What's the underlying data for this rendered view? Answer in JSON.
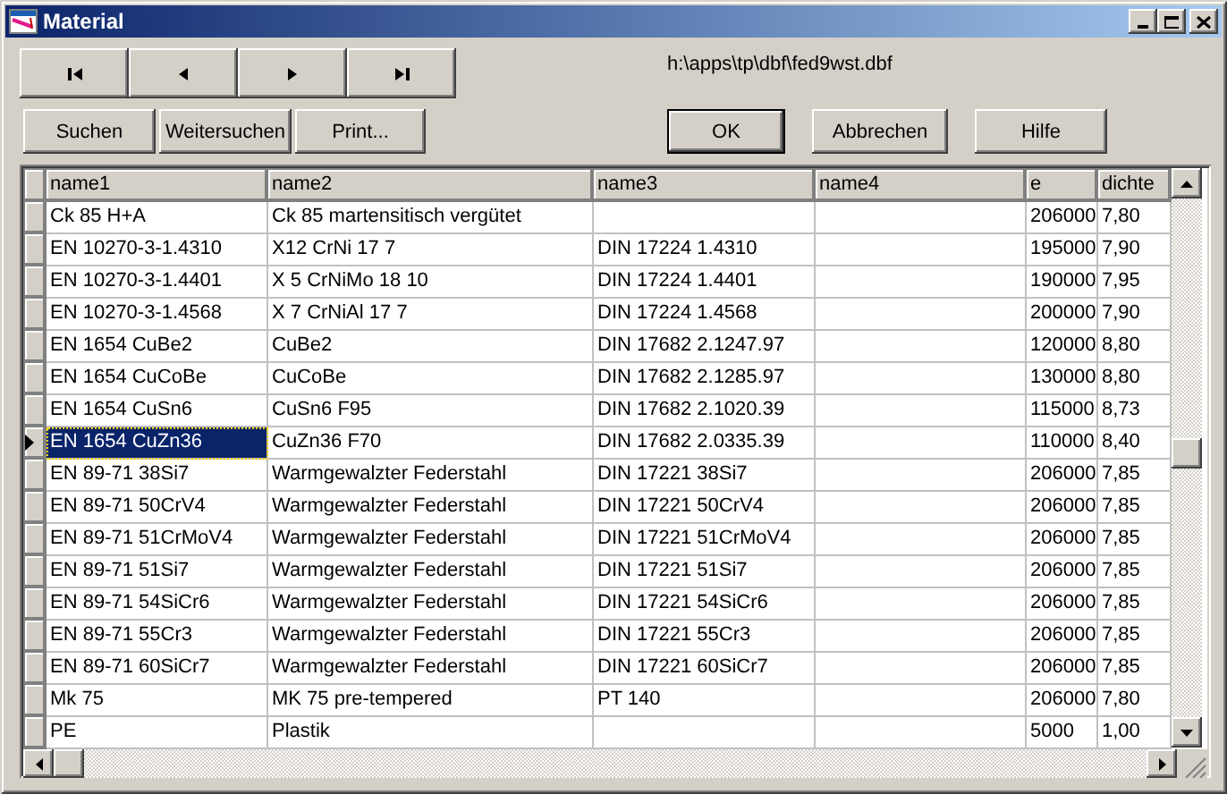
{
  "window": {
    "title": "Material"
  },
  "nav_buttons": [
    {
      "kind": "first"
    },
    {
      "kind": "previous"
    },
    {
      "kind": "next"
    },
    {
      "kind": "last"
    }
  ],
  "file_path": "h:\\apps\\tp\\dbf\\fed9wst.dbf",
  "left_buttons": [
    "Suchen",
    "Weitersuchen",
    "Print..."
  ],
  "right_buttons": [
    {
      "label": "OK",
      "default": true
    },
    {
      "label": "Abbrechen",
      "default": false
    },
    {
      "label": "Hilfe",
      "default": false
    }
  ],
  "table": {
    "columns": [
      "name1",
      "name2",
      "name3",
      "name4",
      "e",
      "dichte"
    ],
    "rows": [
      {
        "selected": false,
        "cells": [
          "Ck 85 H+A",
          "Ck 85 martensitisch vergütet",
          "",
          "",
          "206000",
          "7,80"
        ]
      },
      {
        "selected": false,
        "cells": [
          "EN 10270-3-1.4310",
          "X12 CrNi 17 7",
          "DIN 17224 1.4310",
          "",
          "195000",
          "7,90"
        ]
      },
      {
        "selected": false,
        "cells": [
          "EN 10270-3-1.4401",
          "X 5 CrNiMo 18 10",
          "DIN 17224 1.4401",
          "",
          "190000",
          "7,95"
        ]
      },
      {
        "selected": false,
        "cells": [
          "EN 10270-3-1.4568",
          "X 7 CrNiAl 17 7",
          "DIN 17224 1.4568",
          "",
          "200000",
          "7,90"
        ]
      },
      {
        "selected": false,
        "cells": [
          "EN 1654 CuBe2",
          "CuBe2",
          "DIN 17682 2.1247.97",
          "",
          "120000",
          "8,80"
        ]
      },
      {
        "selected": false,
        "cells": [
          "EN 1654 CuCoBe",
          "CuCoBe",
          "DIN 17682 2.1285.97",
          "",
          "130000",
          "8,80"
        ]
      },
      {
        "selected": false,
        "cells": [
          "EN 1654 CuSn6",
          "CuSn6 F95",
          "DIN 17682 2.1020.39",
          "",
          "115000",
          "8,73"
        ]
      },
      {
        "selected": true,
        "cells": [
          "EN 1654 CuZn36",
          "CuZn36 F70",
          "DIN 17682 2.0335.39",
          "",
          "110000",
          "8,40"
        ]
      },
      {
        "selected": false,
        "cells": [
          "EN 89-71 38Si7",
          "Warmgewalzter Federstahl",
          "DIN 17221 38Si7",
          "",
          "206000",
          "7,85"
        ]
      },
      {
        "selected": false,
        "cells": [
          "EN 89-71 50CrV4",
          "Warmgewalzter Federstahl",
          "DIN 17221 50CrV4",
          "",
          "206000",
          "7,85"
        ]
      },
      {
        "selected": false,
        "cells": [
          "EN 89-71 51CrMoV4",
          "Warmgewalzter Federstahl",
          "DIN 17221 51CrMoV4",
          "",
          "206000",
          "7,85"
        ]
      },
      {
        "selected": false,
        "cells": [
          "EN 89-71 51Si7",
          "Warmgewalzter Federstahl",
          "DIN 17221 51Si7",
          "",
          "206000",
          "7,85"
        ]
      },
      {
        "selected": false,
        "cells": [
          "EN 89-71 54SiCr6",
          "Warmgewalzter Federstahl",
          "DIN 17221 54SiCr6",
          "",
          "206000",
          "7,85"
        ]
      },
      {
        "selected": false,
        "cells": [
          "EN 89-71 55Cr3",
          "Warmgewalzter Federstahl",
          "DIN 17221 55Cr3",
          "",
          "206000",
          "7,85"
        ]
      },
      {
        "selected": false,
        "cells": [
          "EN 89-71 60SiCr7",
          "Warmgewalzter Federstahl",
          "DIN 17221 60SiCr7",
          "",
          "206000",
          "7,85"
        ]
      },
      {
        "selected": false,
        "cells": [
          "Mk 75",
          "MK 75 pre-tempered",
          "PT 140",
          "",
          "206000",
          "7,80"
        ]
      },
      {
        "selected": false,
        "cells": [
          "PE",
          "Plastik",
          "",
          "",
          "5000",
          "1,00"
        ]
      }
    ]
  }
}
